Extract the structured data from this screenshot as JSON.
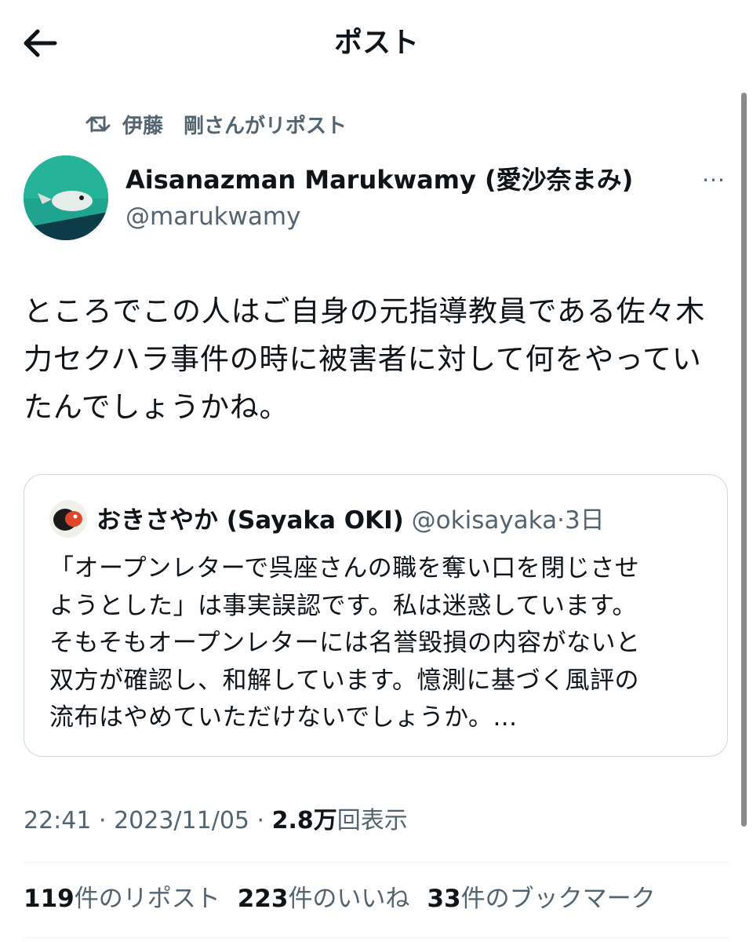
{
  "header": {
    "title": "ポスト",
    "back_icon": "arrow-left-icon"
  },
  "repost": {
    "text": "伊藤　剛さんがリポスト",
    "icon": "repost-icon"
  },
  "author": {
    "name": "Aisanazman Marukwamy (愛沙奈まみ)",
    "handle": "@marukwamy",
    "more": "···"
  },
  "post": {
    "text": "ところでこの人はご自身の元指導教員である佐々木\n力セクハラ事件の時に被害者に対して何をやってい\nたんでしょうかね。"
  },
  "quote": {
    "name": "おきさやか (Sayaka OKI)",
    "handle": "@okisayaka",
    "dot": "·",
    "time": "3日",
    "text": "「オープンレターで呉座さんの職を奪い口を閉じさせ\nようとした」は事実誤認です。私は迷惑しています。\nそもそもオープンレターには名誉毀損の内容がないと\n双方が確認し、和解しています。憶測に基づく風評の\n流布はやめていただけないでしょうか。..."
  },
  "meta": {
    "time": "22:41",
    "sep1": " · ",
    "date": "2023/11/05",
    "sep2": " · ",
    "views_count": "2.8万",
    "views_label": "回表示"
  },
  "stats": {
    "reposts": {
      "count": "119",
      "label": "件のリポスト"
    },
    "likes": {
      "count": "223",
      "label": "件のいいね"
    },
    "bookmarks": {
      "count": "33",
      "label": "件のブックマーク"
    }
  },
  "colors": {
    "text": "#0f1419",
    "secondary": "#536471",
    "border": "#cfd9de",
    "avatar_bg": "#23a994"
  }
}
